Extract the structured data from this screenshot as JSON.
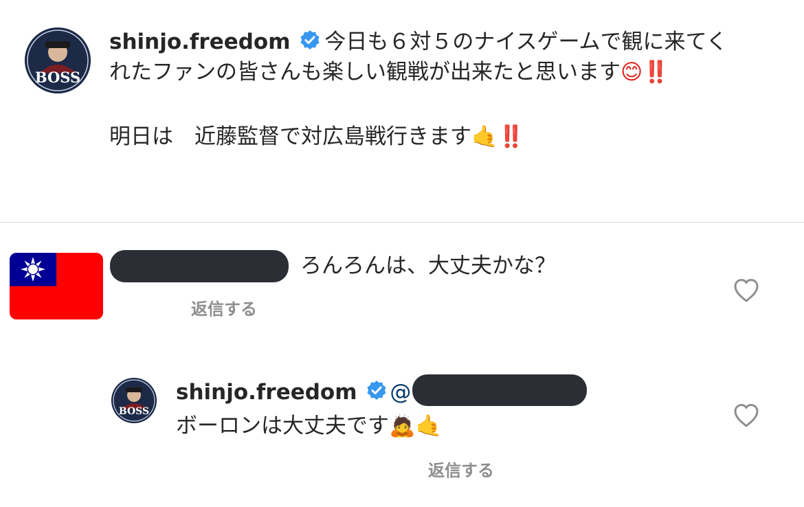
{
  "post": {
    "username": "shinjo.freedom",
    "caption_line1": "今日も６対５のナイスゲームで観に来てく",
    "caption_line2": "れたファンの皆さんも楽しい観戦が出来たと思います",
    "caption_line2_emoji": "😊‼️",
    "caption_line3": "明日は　近藤監督で対広島戦行きます",
    "caption_line3_emoji": "🤙‼️",
    "avatar_text": "BOSS"
  },
  "comments": [
    {
      "avatar_icon": "taiwan-flag-icon",
      "username_redacted": true,
      "text": "ろんろんは、大丈夫かな？",
      "reply_label": "返信する",
      "like_icon": "heart-icon"
    },
    {
      "username": "shinjo.freedom",
      "mention_prefix": "@",
      "mention_redacted": true,
      "text": "ボーロンは大丈夫です",
      "text_emoji": "🙇🤙",
      "reply_label": "返信する",
      "like_icon": "heart-icon",
      "avatar_text": "BOSS"
    }
  ],
  "colors": {
    "text": "#262626",
    "secondary": "#8e8e8e",
    "verified": "#3897f0",
    "divider": "#dbdbdb",
    "flag_red": "#fe0000",
    "flag_blue": "#000095"
  }
}
